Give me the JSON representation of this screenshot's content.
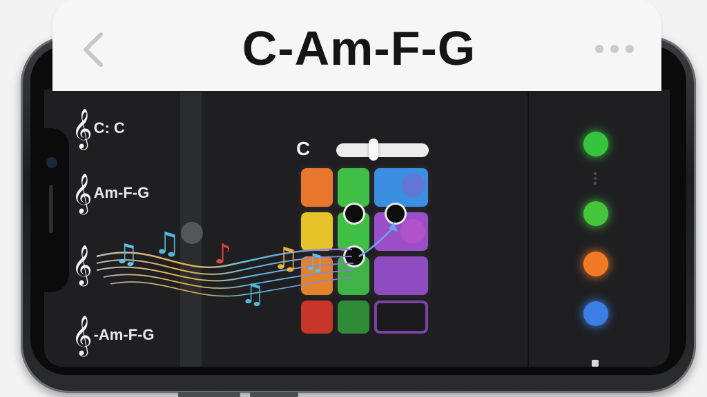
{
  "header": {
    "title": "C-Am-F-G",
    "back_icon": "chevron-left-icon",
    "more_icon": "more-horizontal-icon"
  },
  "progressions": [
    {
      "clef": "𝄞",
      "label": "C: C"
    },
    {
      "clef": "𝄞",
      "label": "Am-F-G"
    },
    {
      "clef": "𝄞",
      "label": ""
    },
    {
      "clef": "𝄞",
      "label": "-Am-F-G"
    }
  ],
  "editor": {
    "chord": "C",
    "slider_value": 0.42,
    "pad_colors": {
      "orange": "#e8762c",
      "green": "#3fbf46",
      "blue": "#3a8fe0",
      "yellow": "#e6c328",
      "purple": "#9a4fc9",
      "red": "#c8352b"
    }
  },
  "indicators": [
    {
      "color": "#36c43f",
      "name": "green-led"
    },
    {
      "color": "#45c53c",
      "name": "green-led-2"
    },
    {
      "color": "#f07a24",
      "name": "orange-led"
    },
    {
      "color": "#3b7fe6",
      "name": "blue-led"
    }
  ],
  "notes_icon": "music-notes-icon"
}
